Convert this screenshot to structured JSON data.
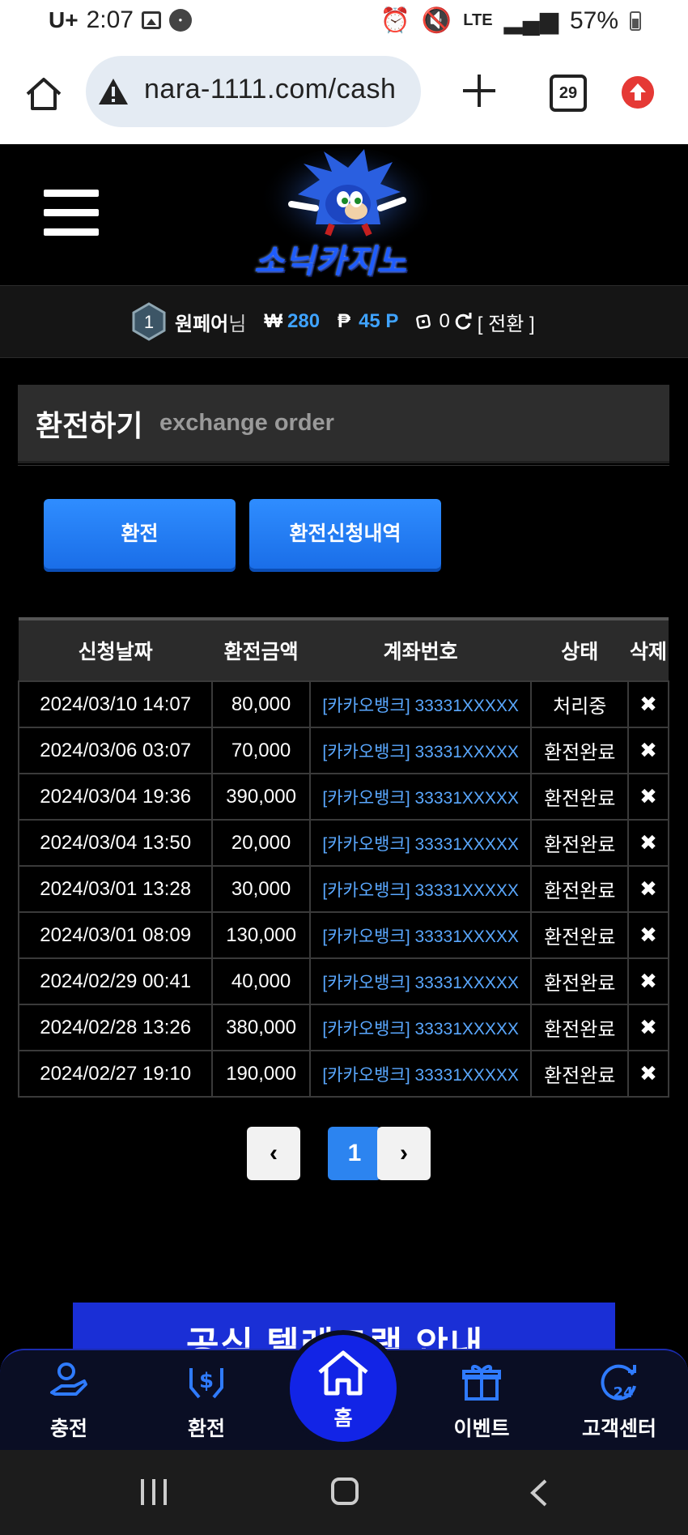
{
  "status_bar": {
    "carrier": "U+",
    "time": "2:07",
    "network": "LTE",
    "battery": "57%"
  },
  "browser": {
    "url": "nara-1111.com/cash",
    "tab_count": "29"
  },
  "site": {
    "logo_text": "소닉카지노"
  },
  "user": {
    "level": "1",
    "name": "원페어",
    "suffix": "님",
    "currency_symbol": "₩",
    "money": "280",
    "point_symbol": "₱",
    "points": "45 P",
    "chips": "0",
    "switch_label": "[ 전환 ]"
  },
  "section": {
    "title": "환전하기",
    "subtitle": "exchange order"
  },
  "buttons": {
    "exchange": "환전",
    "history": "환전신청내역"
  },
  "table": {
    "headers": [
      "신청날짜",
      "환전금액",
      "계좌번호",
      "상태",
      "삭제"
    ],
    "rows": [
      {
        "date": "2024/03/10 14:07",
        "amount": "80,000",
        "account": "[카카오뱅크] 33331XXXXX",
        "status": "처리중",
        "del": "✖"
      },
      {
        "date": "2024/03/06 03:07",
        "amount": "70,000",
        "account": "[카카오뱅크] 33331XXXXX",
        "status": "환전완료",
        "del": "✖"
      },
      {
        "date": "2024/03/04 19:36",
        "amount": "390,000",
        "account": "[카카오뱅크] 33331XXXXX",
        "status": "환전완료",
        "del": "✖"
      },
      {
        "date": "2024/03/04 13:50",
        "amount": "20,000",
        "account": "[카카오뱅크] 33331XXXXX",
        "status": "환전완료",
        "del": "✖"
      },
      {
        "date": "2024/03/01 13:28",
        "amount": "30,000",
        "account": "[카카오뱅크] 33331XXXXX",
        "status": "환전완료",
        "del": "✖"
      },
      {
        "date": "2024/03/01 08:09",
        "amount": "130,000",
        "account": "[카카오뱅크] 33331XXXXX",
        "status": "환전완료",
        "del": "✖"
      },
      {
        "date": "2024/02/29 00:41",
        "amount": "40,000",
        "account": "[카카오뱅크] 33331XXXXX",
        "status": "환전완료",
        "del": "✖"
      },
      {
        "date": "2024/02/28 13:26",
        "amount": "380,000",
        "account": "[카카오뱅크] 33331XXXXX",
        "status": "환전완료",
        "del": "✖"
      },
      {
        "date": "2024/02/27 19:10",
        "amount": "190,000",
        "account": "[카카오뱅크] 33331XXXXX",
        "status": "환전완료",
        "del": "✖"
      }
    ]
  },
  "pagination": {
    "prev": "‹",
    "current": "1",
    "next": "›"
  },
  "banner": {
    "text": "공식 텔레그램 안내"
  },
  "bottom_nav": {
    "charge": "충전",
    "exchange": "환전",
    "home": "홈",
    "event": "이벤트",
    "support": "고객센터"
  },
  "colors": {
    "accent_blue": "#2c84f0",
    "money_blue": "#3fa3ff",
    "home_circle": "#1224e6"
  }
}
